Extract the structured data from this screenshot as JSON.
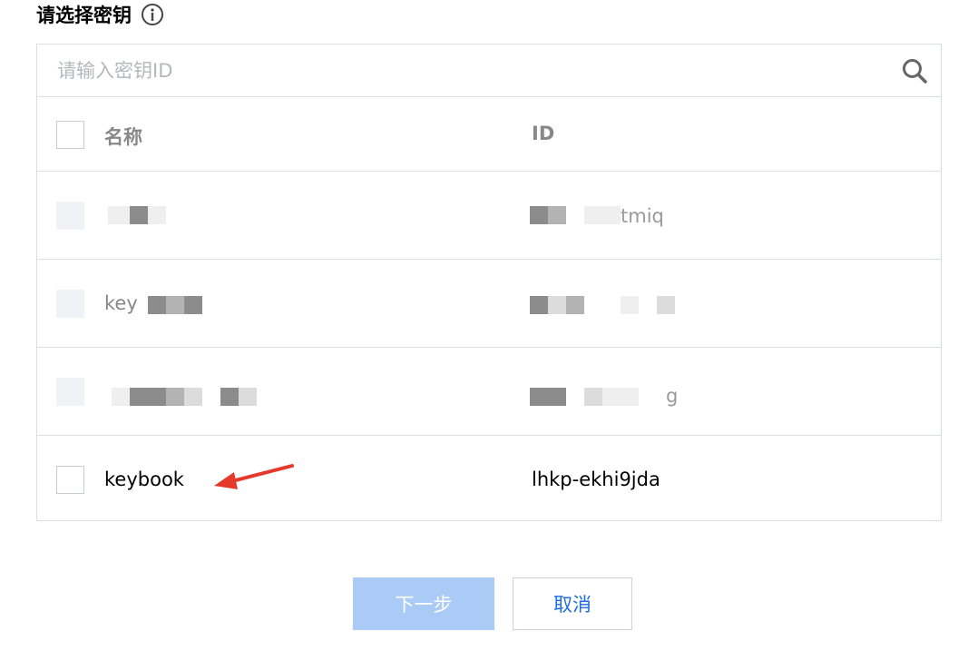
{
  "title": "请选择密钥",
  "search": {
    "placeholder": "请输入密钥ID"
  },
  "table": {
    "headers": {
      "name": "名称",
      "id": "ID"
    },
    "rows": [
      {
        "name": "",
        "id": "tmiq",
        "masked": true
      },
      {
        "name": "key",
        "id": "",
        "masked": true
      },
      {
        "name": "",
        "id": "g",
        "masked": true
      },
      {
        "name": "keybook",
        "id": "lhkp-ekhi9jda",
        "masked": false
      }
    ]
  },
  "buttons": {
    "next": "下一步",
    "cancel": "取消"
  },
  "colors": {
    "primary": "#1d6de0",
    "primary_disabled": "#a9cbf5",
    "border": "#dcdee6",
    "annotation_arrow": "#e53a2b"
  },
  "icons": {
    "info": "info-icon",
    "search": "search-icon",
    "arrow": "annotation-arrow-icon"
  }
}
